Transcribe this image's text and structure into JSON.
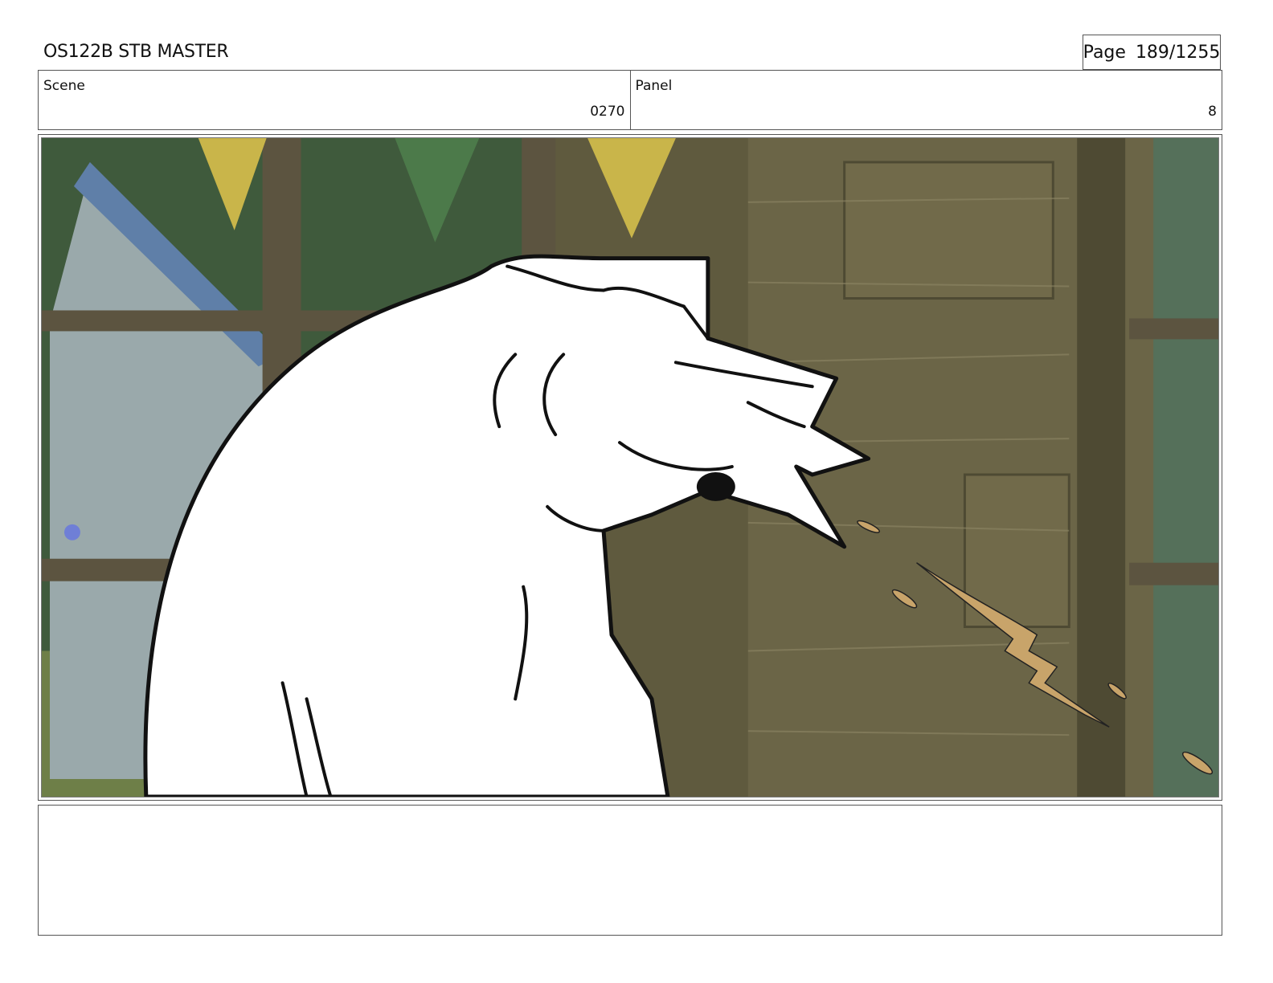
{
  "header": {
    "title": "OS122B STB MASTER",
    "page_label": "Page",
    "page_number": "189/1255"
  },
  "info": {
    "scene_label": "Scene",
    "scene_value": "0270",
    "panel_label": "Panel",
    "panel_value": "8"
  },
  "colors": {
    "wall": "#6b6547",
    "wall_dark": "#4e4a33",
    "foliage": "#3f5a3c",
    "window_frame": "#5c5440",
    "pennant_yellow": "#c9b54a",
    "pennant_green": "#4c7a4a",
    "spit": "#c8a46a"
  },
  "notes": {
    "text": ""
  }
}
